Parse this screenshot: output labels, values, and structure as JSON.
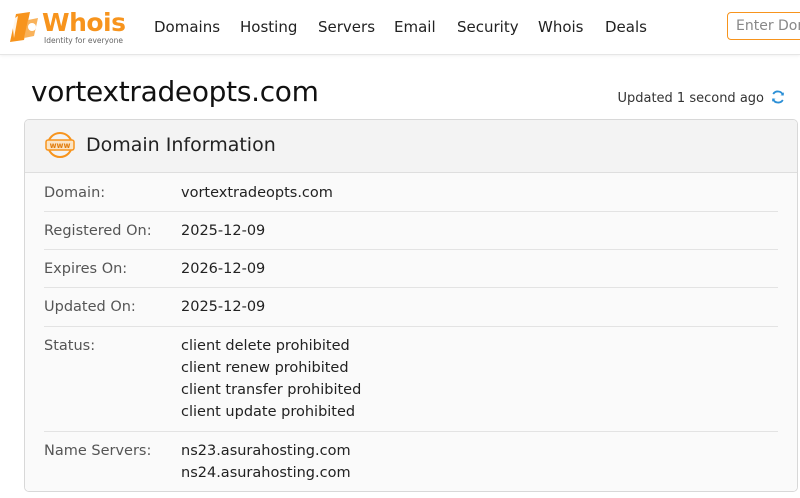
{
  "brand": {
    "name": "Whois",
    "tagline": "Identity for everyone",
    "color": "#f7941d"
  },
  "nav": {
    "items": [
      "Domains",
      "Hosting",
      "Servers",
      "Email",
      "Security",
      "Whois",
      "Deals"
    ]
  },
  "search": {
    "placeholder": "Enter Domain or IP"
  },
  "page": {
    "title": "vortextradeopts.com",
    "updated_text": "Updated 1 second ago",
    "refresh_icon": "refresh-icon"
  },
  "card": {
    "icon": "www-icon",
    "title": "Domain Information",
    "rows": [
      {
        "label": "Domain:",
        "values": [
          "vortextradeopts.com"
        ]
      },
      {
        "label": "Registered On:",
        "values": [
          "2025-12-09"
        ]
      },
      {
        "label": "Expires On:",
        "values": [
          "2026-12-09"
        ]
      },
      {
        "label": "Updated On:",
        "values": [
          "2025-12-09"
        ]
      },
      {
        "label": "Status:",
        "values": [
          "client delete prohibited",
          "client renew prohibited",
          "client transfer prohibited",
          "client update prohibited"
        ]
      },
      {
        "label": "Name Servers:",
        "values": [
          "ns23.asurahosting.com",
          "ns24.asurahosting.com"
        ]
      }
    ]
  }
}
